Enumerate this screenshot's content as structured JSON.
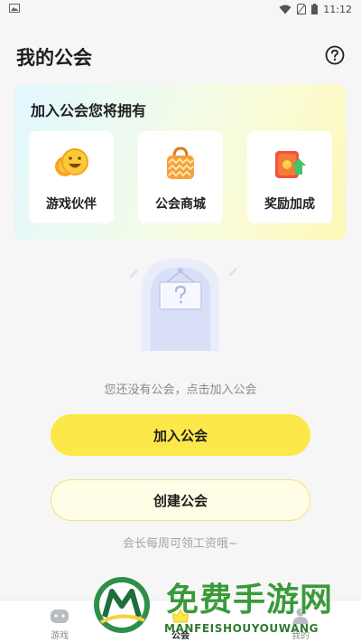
{
  "status_bar": {
    "time": "11:12"
  },
  "header": {
    "title": "我的公会"
  },
  "benefits": {
    "title": "加入公会您将拥有",
    "items": [
      {
        "label": "游戏伙伴",
        "icon": "smiley-coins-icon"
      },
      {
        "label": "公会商城",
        "icon": "shopping-bag-icon"
      },
      {
        "label": "奖励加成",
        "icon": "reward-boost-icon"
      }
    ]
  },
  "empty_state": {
    "message": "您还没有公会，点击加入公会"
  },
  "actions": {
    "join_label": "加入公会",
    "create_label": "创建公会",
    "hint": "会长每周可领工资哦~"
  },
  "bottom_nav": {
    "items": [
      {
        "label": "游戏",
        "icon": "gamepad-icon"
      },
      {
        "label": "公会",
        "icon": "crown-icon",
        "active": true
      },
      {
        "label": "我的",
        "icon": "profile-icon"
      }
    ]
  },
  "watermark": {
    "text_cn": "免费手游网",
    "text_en": "MANFEISHOUYOUWANG"
  },
  "colors": {
    "accent_yellow": "#fde84a",
    "background": "#f6f6f6"
  }
}
